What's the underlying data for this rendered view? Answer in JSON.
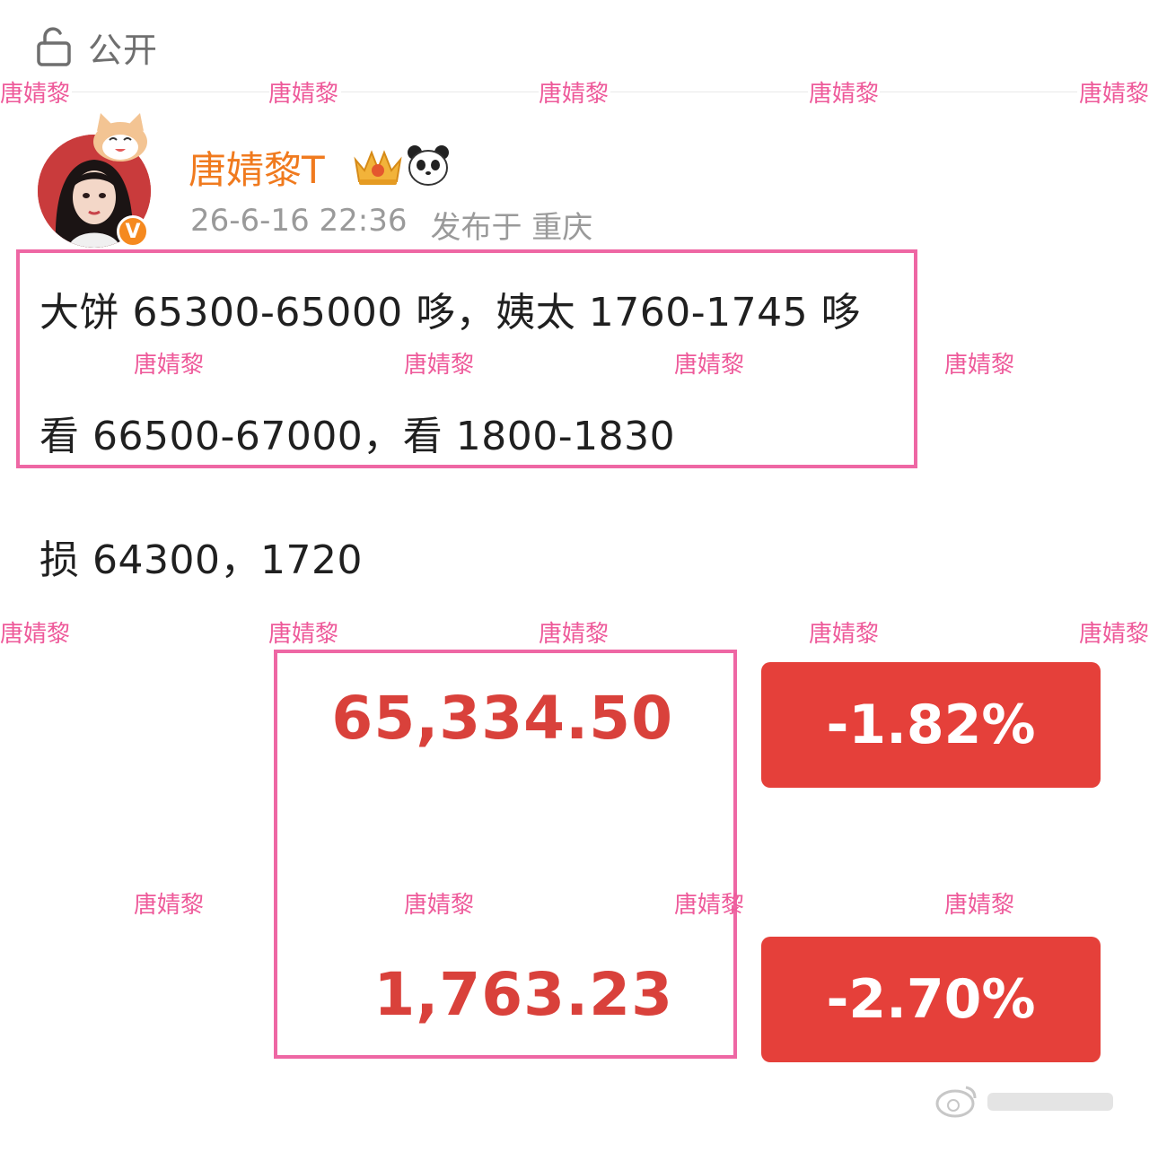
{
  "visibility": {
    "label": "公开",
    "icon": "unlock-icon"
  },
  "watermark": {
    "text": "唐婧黎"
  },
  "author": {
    "name": "唐婧黎T",
    "verified_mark": "V",
    "badges": [
      "crown-badge-icon",
      "panda-icon"
    ],
    "time": "26-6-16 22:36",
    "location": "发布于 重庆"
  },
  "post": {
    "line1": "大饼 65300-65000 哆，姨太 1760-1745 哆",
    "line2": "看 66500-67000，看 1800-1830",
    "line3": "损 64300，1720"
  },
  "quotes": [
    {
      "price": "65,334.50",
      "change": "-1.82%"
    },
    {
      "price": "1,763.23",
      "change": "-2.70%"
    }
  ],
  "colors": {
    "accent_pink": "#ee67a4",
    "down_red": "#e5403a",
    "username_orange": "#f07a1e"
  }
}
